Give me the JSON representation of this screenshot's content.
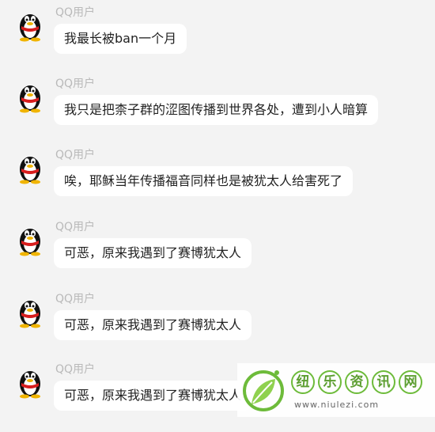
{
  "messages": [
    {
      "sender": "QQ用户",
      "text": "我最长被ban一个月"
    },
    {
      "sender": "QQ用户",
      "text": "我只是把柰子群的涩图传播到世界各处，遭到小人暗算"
    },
    {
      "sender": "QQ用户",
      "text": "唉，耶稣当年传播福音同样也是被犹太人给害死了"
    },
    {
      "sender": "QQ用户",
      "text": "可恶，原来我遇到了赛博犹太人"
    },
    {
      "sender": "QQ用户",
      "text": "可恶，原来我遇到了赛博犹太人"
    },
    {
      "sender": "QQ用户",
      "text": "可恶，原来我遇到了赛博犹太人"
    }
  ],
  "watermark": {
    "chars": [
      "纽",
      "乐",
      "资",
      "讯",
      "网"
    ],
    "url": "www.niulezi.com",
    "brand_color": "#6dbb3a"
  },
  "icons": {
    "avatar": "qq-penguin-icon",
    "logo": "leaf-logo-icon"
  }
}
